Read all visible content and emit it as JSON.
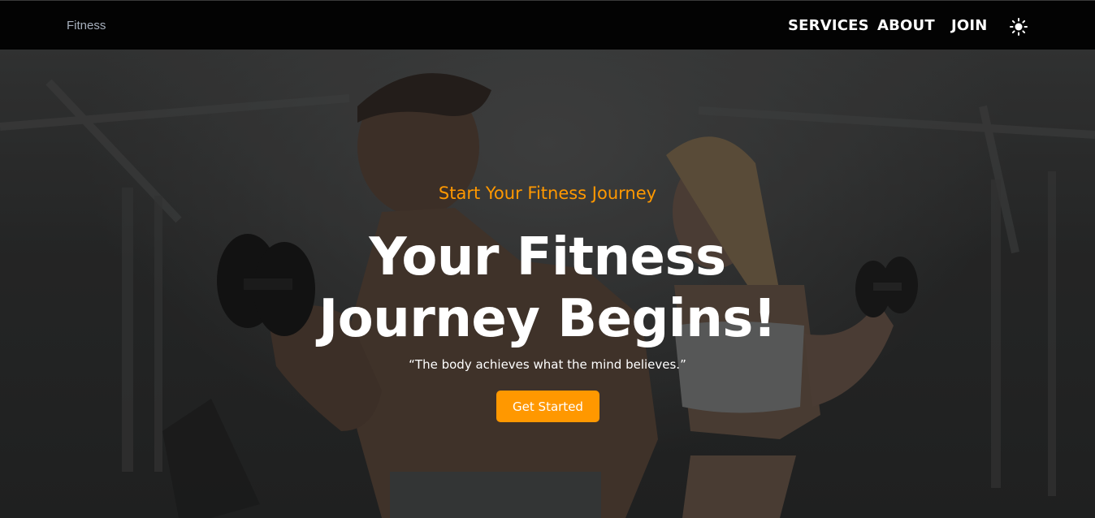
{
  "navbar": {
    "brand": "Fitness",
    "links": [
      {
        "label": "SERVICES"
      },
      {
        "label": "ABOUT"
      },
      {
        "label": "JOIN"
      }
    ],
    "theme_icon": "sun-icon"
  },
  "hero": {
    "subtitle": "Start Your Fitness Journey",
    "headline_line1": "Your Fitness",
    "headline_line2": "Journey Begins!",
    "quote": "“The body achieves what the mind believes.”",
    "cta_label": "Get Started",
    "background_image": "gym-couple-dumbbells-photo"
  },
  "colors": {
    "nav_background": "#030303",
    "accent": "#ff9800",
    "text": "#ffffff",
    "brand_text": "#a7b0bd"
  }
}
